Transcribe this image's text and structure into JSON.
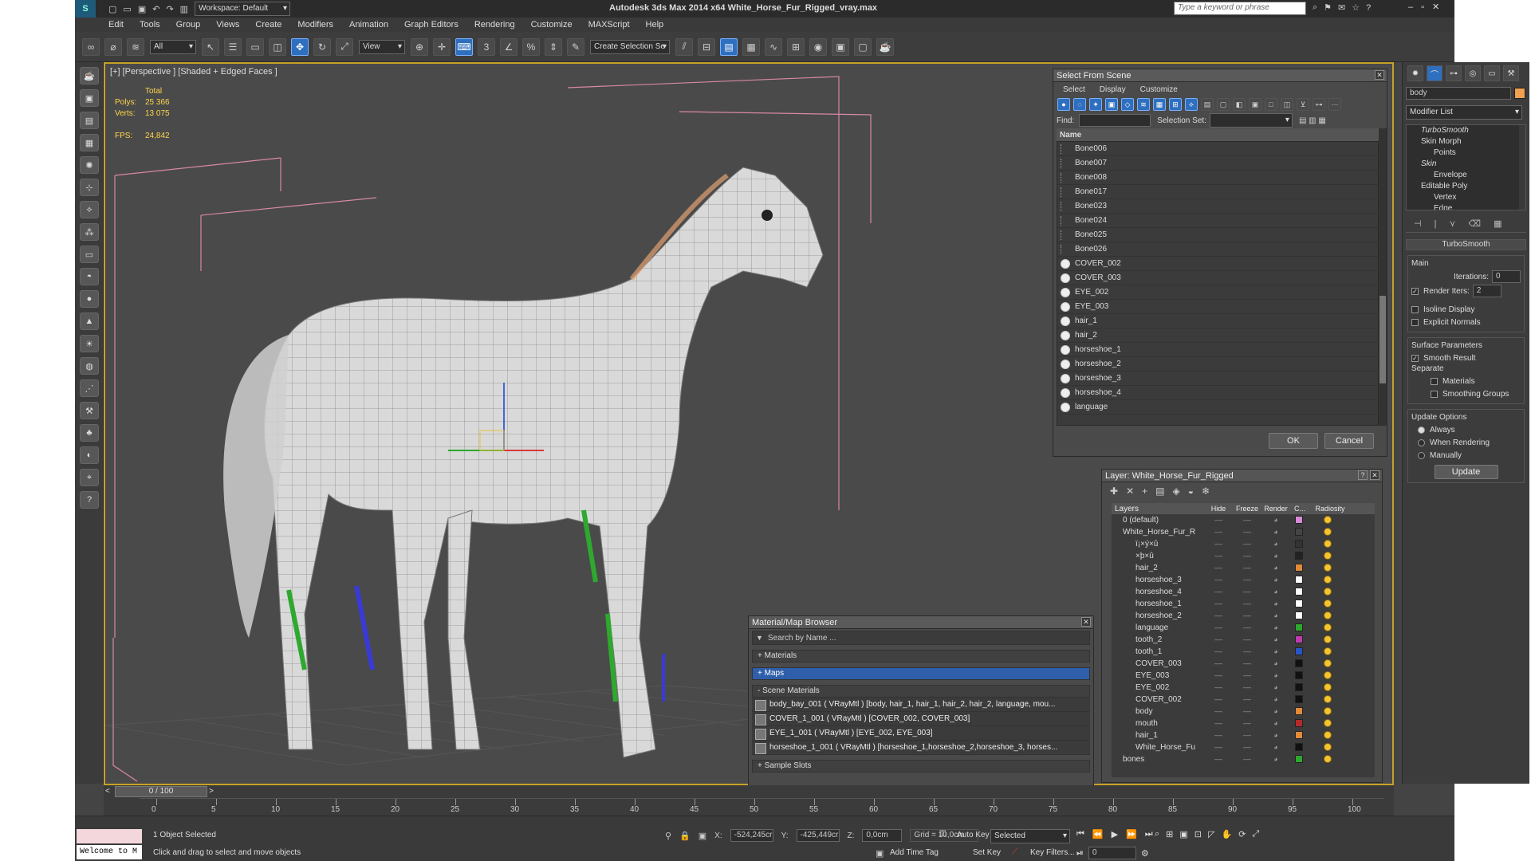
{
  "window": {
    "title": "Autodesk 3ds Max  2014 x64     White_Horse_Fur_Rigged_vray.max",
    "workspace": "Workspace: Default",
    "search_placeholder": "Type a keyword or phrase"
  },
  "menu": [
    "Edit",
    "Tools",
    "Group",
    "Views",
    "Create",
    "Modifiers",
    "Animation",
    "Graph Editors",
    "Rendering",
    "Customize",
    "MAXScript",
    "Help"
  ],
  "toolbar": {
    "selection_filter": "All",
    "ref_coord": "View",
    "named_selection": "Create Selection Se"
  },
  "viewport": {
    "label": "[+] [Perspective ] [Shaded + Edged Faces ]",
    "stats": {
      "total_label": "Total",
      "polys_label": "Polys:",
      "polys_value": "25 366",
      "verts_label": "Verts:",
      "verts_value": "13 075",
      "fps_label": "FPS:",
      "fps_value": "24,842"
    }
  },
  "select_from_scene": {
    "title": "Select From Scene",
    "tabs": [
      "Select",
      "Display",
      "Customize"
    ],
    "find_label": "Find:",
    "selection_set_label": "Selection Set:",
    "column_name": "Name",
    "items": [
      {
        "name": "Bone006",
        "type": "bone"
      },
      {
        "name": "Bone007",
        "type": "bone"
      },
      {
        "name": "Bone008",
        "type": "bone"
      },
      {
        "name": "Bone017",
        "type": "bone"
      },
      {
        "name": "Bone023",
        "type": "bone"
      },
      {
        "name": "Bone024",
        "type": "bone"
      },
      {
        "name": "Bone025",
        "type": "bone"
      },
      {
        "name": "Bone026",
        "type": "bone"
      },
      {
        "name": "COVER_002",
        "type": "geom"
      },
      {
        "name": "COVER_003",
        "type": "geom"
      },
      {
        "name": "EYE_002",
        "type": "geom"
      },
      {
        "name": "EYE_003",
        "type": "geom"
      },
      {
        "name": "hair_1",
        "type": "geom"
      },
      {
        "name": "hair_2",
        "type": "geom"
      },
      {
        "name": "horseshoe_1",
        "type": "geom"
      },
      {
        "name": "horseshoe_2",
        "type": "geom"
      },
      {
        "name": "horseshoe_3",
        "type": "geom"
      },
      {
        "name": "horseshoe_4",
        "type": "geom"
      },
      {
        "name": "language",
        "type": "geom"
      }
    ],
    "ok_label": "OK",
    "cancel_label": "Cancel"
  },
  "layer_panel": {
    "title": "Layer: White_Horse_Fur_Rigged",
    "columns": [
      "Layers",
      "Hide",
      "Freeze",
      "Render",
      "C...",
      "Radiosity"
    ],
    "rows": [
      {
        "name": "0 (default)",
        "color": "#d88ad8",
        "indent": 0
      },
      {
        "name": "White_Horse_Fur_R",
        "color": "#444444",
        "indent": 0
      },
      {
        "name": "ï¡×ý×û",
        "color": "#333333",
        "indent": 1
      },
      {
        "name": "×þ×û",
        "color": "#222222",
        "indent": 1
      },
      {
        "name": "hair_2",
        "color": "#e08a3a",
        "indent": 1
      },
      {
        "name": "horseshoe_3",
        "color": "#ffffff",
        "indent": 1
      },
      {
        "name": "horseshoe_4",
        "color": "#ffffff",
        "indent": 1
      },
      {
        "name": "horseshoe_1",
        "color": "#ffffff",
        "indent": 1
      },
      {
        "name": "horseshoe_2",
        "color": "#ffffff",
        "indent": 1
      },
      {
        "name": "language",
        "color": "#2ea82e",
        "indent": 1
      },
      {
        "name": "tooth_2",
        "color": "#c03ab0",
        "indent": 1
      },
      {
        "name": "tooth_1",
        "color": "#2a54c8",
        "indent": 1
      },
      {
        "name": "COVER_003",
        "color": "#111111",
        "indent": 1
      },
      {
        "name": "EYE_003",
        "color": "#111111",
        "indent": 1
      },
      {
        "name": "EYE_002",
        "color": "#111111",
        "indent": 1
      },
      {
        "name": "COVER_002",
        "color": "#111111",
        "indent": 1
      },
      {
        "name": "body",
        "color": "#e08a3a",
        "indent": 1
      },
      {
        "name": "mouth",
        "color": "#b82a2a",
        "indent": 1
      },
      {
        "name": "hair_1",
        "color": "#e08a3a",
        "indent": 1
      },
      {
        "name": "White_Horse_Fu",
        "color": "#111111",
        "indent": 1
      },
      {
        "name": "bones",
        "color": "#2ea82e",
        "indent": 0
      }
    ]
  },
  "material_browser": {
    "title": "Material/Map Browser",
    "search_placeholder": "Search by Name ...",
    "sections": [
      "+ Materials",
      "+ Maps",
      "- Scene Materials",
      "+ Sample Slots"
    ],
    "scene_materials": [
      "body_bay_001  ( VRayMtl ) [body, hair_1, hair_1, hair_2, hair_2, language, mou...",
      "COVER_1_001  ( VRayMtl ) [COVER_002, COVER_003]",
      "EYE_1_001  ( VRayMtl ) [EYE_002, EYE_003]",
      "horseshoe_1_001  ( VRayMtl ) [horseshoe_1,horseshoe_2,horseshoe_3, horses..."
    ]
  },
  "command_panel": {
    "object_name": "body",
    "object_color": "#f0a050",
    "modifier_list": "Modifier List",
    "stack": [
      {
        "label": "TurboSmooth",
        "indent": 0,
        "italic": true
      },
      {
        "label": "Skin Morph",
        "indent": 0,
        "italic": false
      },
      {
        "label": "Points",
        "indent": 1,
        "italic": false
      },
      {
        "label": "Skin",
        "indent": 0,
        "italic": true
      },
      {
        "label": "Envelope",
        "indent": 1,
        "italic": false
      },
      {
        "label": "Editable Poly",
        "indent": 0,
        "italic": false
      },
      {
        "label": "Vertex",
        "indent": 1,
        "italic": false
      },
      {
        "label": "Edge",
        "indent": 1,
        "italic": false
      }
    ],
    "rollout_title": "TurboSmooth",
    "main_label": "Main",
    "iterations_label": "Iterations:",
    "iterations_value": "0",
    "render_iters_label": "Render Iters:",
    "render_iters_value": "2",
    "isoline_label": "Isoline Display",
    "explicit_normals_label": "Explicit Normals",
    "surface_params_label": "Surface Parameters",
    "smooth_result_label": "Smooth Result",
    "separate_label": "Separate",
    "materials_label": "Materials",
    "smoothing_groups_label": "Smoothing Groups",
    "update_options_label": "Update Options",
    "always_label": "Always",
    "when_rendering_label": "When Rendering",
    "manually_label": "Manually",
    "update_button": "Update"
  },
  "timeline": {
    "frame_counter": "0 / 100",
    "ticks": [
      "0",
      "5",
      "10",
      "15",
      "20",
      "25",
      "30",
      "35",
      "40",
      "45",
      "50",
      "55",
      "60",
      "65",
      "70",
      "75",
      "80",
      "85",
      "90",
      "95",
      "100"
    ]
  },
  "status": {
    "selected": "1 Object Selected",
    "prompt": "Click and drag to select and move objects",
    "maxscript": "Welcome to M",
    "x_label": "X:",
    "x_value": "-524,245cr",
    "y_label": "Y:",
    "y_value": "-425,449cr",
    "z_label": "Z:",
    "z_value": "0,0cm",
    "grid": "Grid = 10,0cm",
    "auto_key": "Auto Key",
    "set_key": "Set Key",
    "selected_combo": "Selected",
    "add_time_tag": "Add Time Tag",
    "key_filters": "Key Filters...",
    "frame_value": "0"
  }
}
